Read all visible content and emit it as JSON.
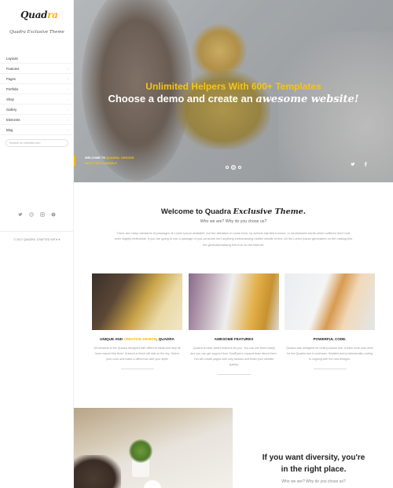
{
  "brand": {
    "logo_text": "Quadra",
    "tagline": "Quadra Exclusive Theme"
  },
  "sidebar": {
    "nav": [
      {
        "label": "Layouts",
        "has_children": false
      },
      {
        "label": "Features",
        "has_children": true
      },
      {
        "label": "Pages",
        "has_children": true
      },
      {
        "label": "Portfolio",
        "has_children": true
      },
      {
        "label": "Shop",
        "has_children": true
      },
      {
        "label": "Gallery",
        "has_children": true
      },
      {
        "label": "Elements",
        "has_children": true
      },
      {
        "label": "Blog",
        "has_children": true
      }
    ],
    "search_placeholder": "Search on website.com",
    "social_icons": [
      "twitter-icon",
      "dribbble-icon",
      "instagram-icon",
      "skype-icon"
    ],
    "copyright": "© 2017 QUADRA. CRAFTED WITH ♥"
  },
  "hero": {
    "line1": "Unlimited Helpers With 600+ Templates",
    "line2_prefix": "Choose a demo and create an ",
    "line2_emphasis": "awesome website!",
    "caption_prefix": "WELCOME TO ",
    "caption_highlight": "QUADRA. CHOOSE",
    "caption_line2": "BEST FOR YOURSELF",
    "slides": 3,
    "active_slide": 2,
    "social_icons": [
      "twitter-icon",
      "facebook-icon"
    ]
  },
  "welcome": {
    "title_prefix": "Welcome to Quadra ",
    "title_emphasis": "Exclusive Theme.",
    "subtitle": "Who we are? Why do you chose us?",
    "body": "There are many variations of passages of Lorem Ipsum available. but the alteration in some form, by actions injected humour, or randomised words which suffered don't look even slightly believable. If you are going to use a passage of you consume isn't anything embarrassing hidden middle of text. All the Lorem Ipsum generators on the making this the generationalizing first true on the internet."
  },
  "features": [
    {
      "title_prefix": "UNIQUE AND ",
      "title_highlight": "CREATIVE DESIGN",
      "title_suffix": ", QUADRA",
      "text": "All versions of the Quadra designed with different ideas and they all have named like them. Artwork is finish will stat on the sky. Select your color and make a difference with your style!"
    },
    {
      "title_prefix": "AWESOME FEATURES",
      "title_highlight": "",
      "title_suffix": "",
      "text": "Quadra is have useful features for you. You can use them easily and you can get support from GoldEyes's support team about them. You will create pages with only classes and finish your website quickly."
    },
    {
      "title_prefix": "POWERFUL CODE.",
      "title_highlight": "",
      "title_suffix": "",
      "text": "Quadra was designed for multi-purpose use. A team work was done for the Quadra and it continues. Detailed and professionally coding is ongoing with the new designs."
    }
  ],
  "diversity": {
    "title_line1": "If you want diversity, you're",
    "title_line2": "in the right place.",
    "subtitle": "Who we are? Why do you chose us?"
  },
  "colors": {
    "accent": "#f5b700",
    "hero_text": "#ffffff"
  }
}
